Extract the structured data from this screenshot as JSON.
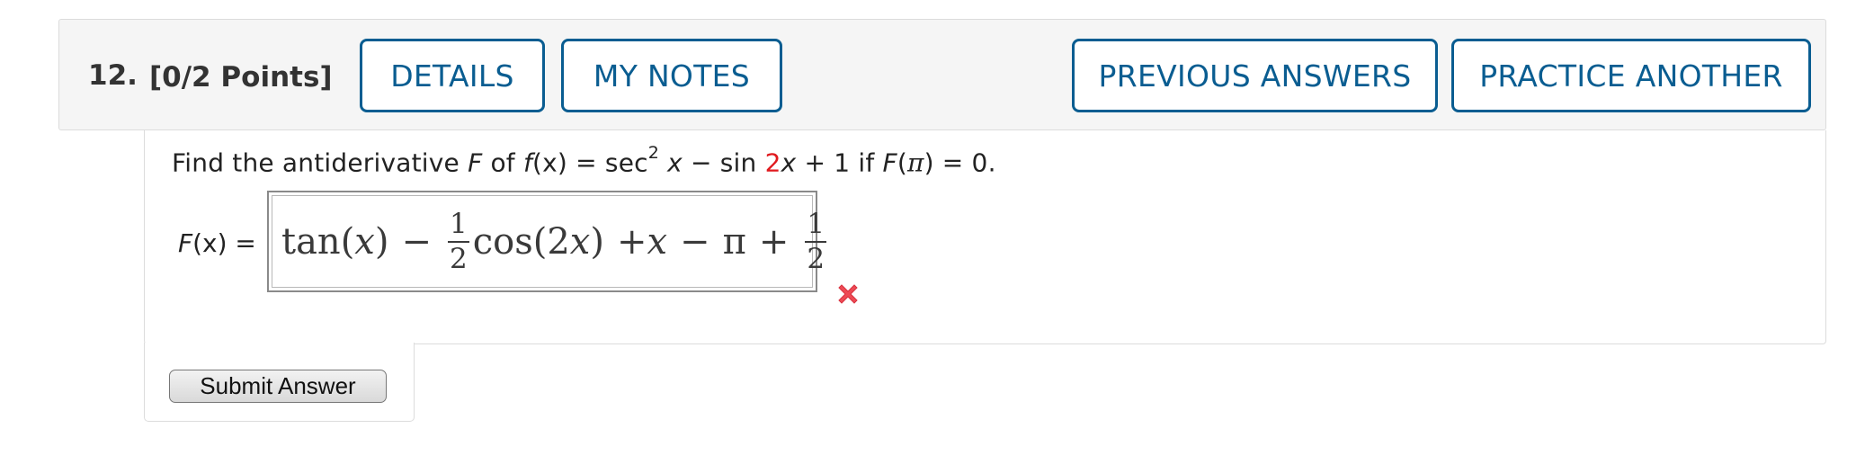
{
  "question": {
    "number": "12.",
    "points": "[0/2 Points]"
  },
  "header_buttons": {
    "details": "DETAILS",
    "my_notes": "MY NOTES",
    "previous_answers": "PREVIOUS ANSWERS",
    "practice_another": "PRACTICE ANOTHER"
  },
  "prompt": {
    "find": "Find the antiderivative ",
    "F": "F",
    "of": " of ",
    "f_lhs": "f",
    "x_paren": "(x)",
    "eq": " = sec",
    "sq": "2",
    "x": " x",
    "minus_sin": " − sin ",
    "two_red": "2",
    "x2": "x",
    "plus_one": " + 1 ",
    "if": " if ",
    "F2": "F",
    "pi_paren_open": "(",
    "pi": "π",
    "pi_paren_close": ")",
    "eq_zero": " = 0."
  },
  "answer": {
    "label_F": "F",
    "label_rest": "(x) =",
    "tan": "tan",
    "paren_x_open": "(",
    "x_var": "x",
    "paren_x_close": ")",
    "minus1": "−",
    "frac1_num": "1",
    "frac1_den": "2",
    "cos": "cos",
    "paren_2x_open": "(",
    "two": "2",
    "x_var2": "x",
    "paren_2x_close": ")",
    "plus_x": "+",
    "x_var3": "x",
    "minus_pi": "−",
    "pi": "π",
    "plus2": "+",
    "frac2_num": "1",
    "frac2_den": "2",
    "status_icon": "wrong-x-icon",
    "status_color": "#ee4a55"
  },
  "submit": {
    "label": "Submit Answer"
  },
  "colors": {
    "button_border": "#0a5d91",
    "header_bg": "#f5f5f5",
    "highlight_red": "#e0191e"
  }
}
